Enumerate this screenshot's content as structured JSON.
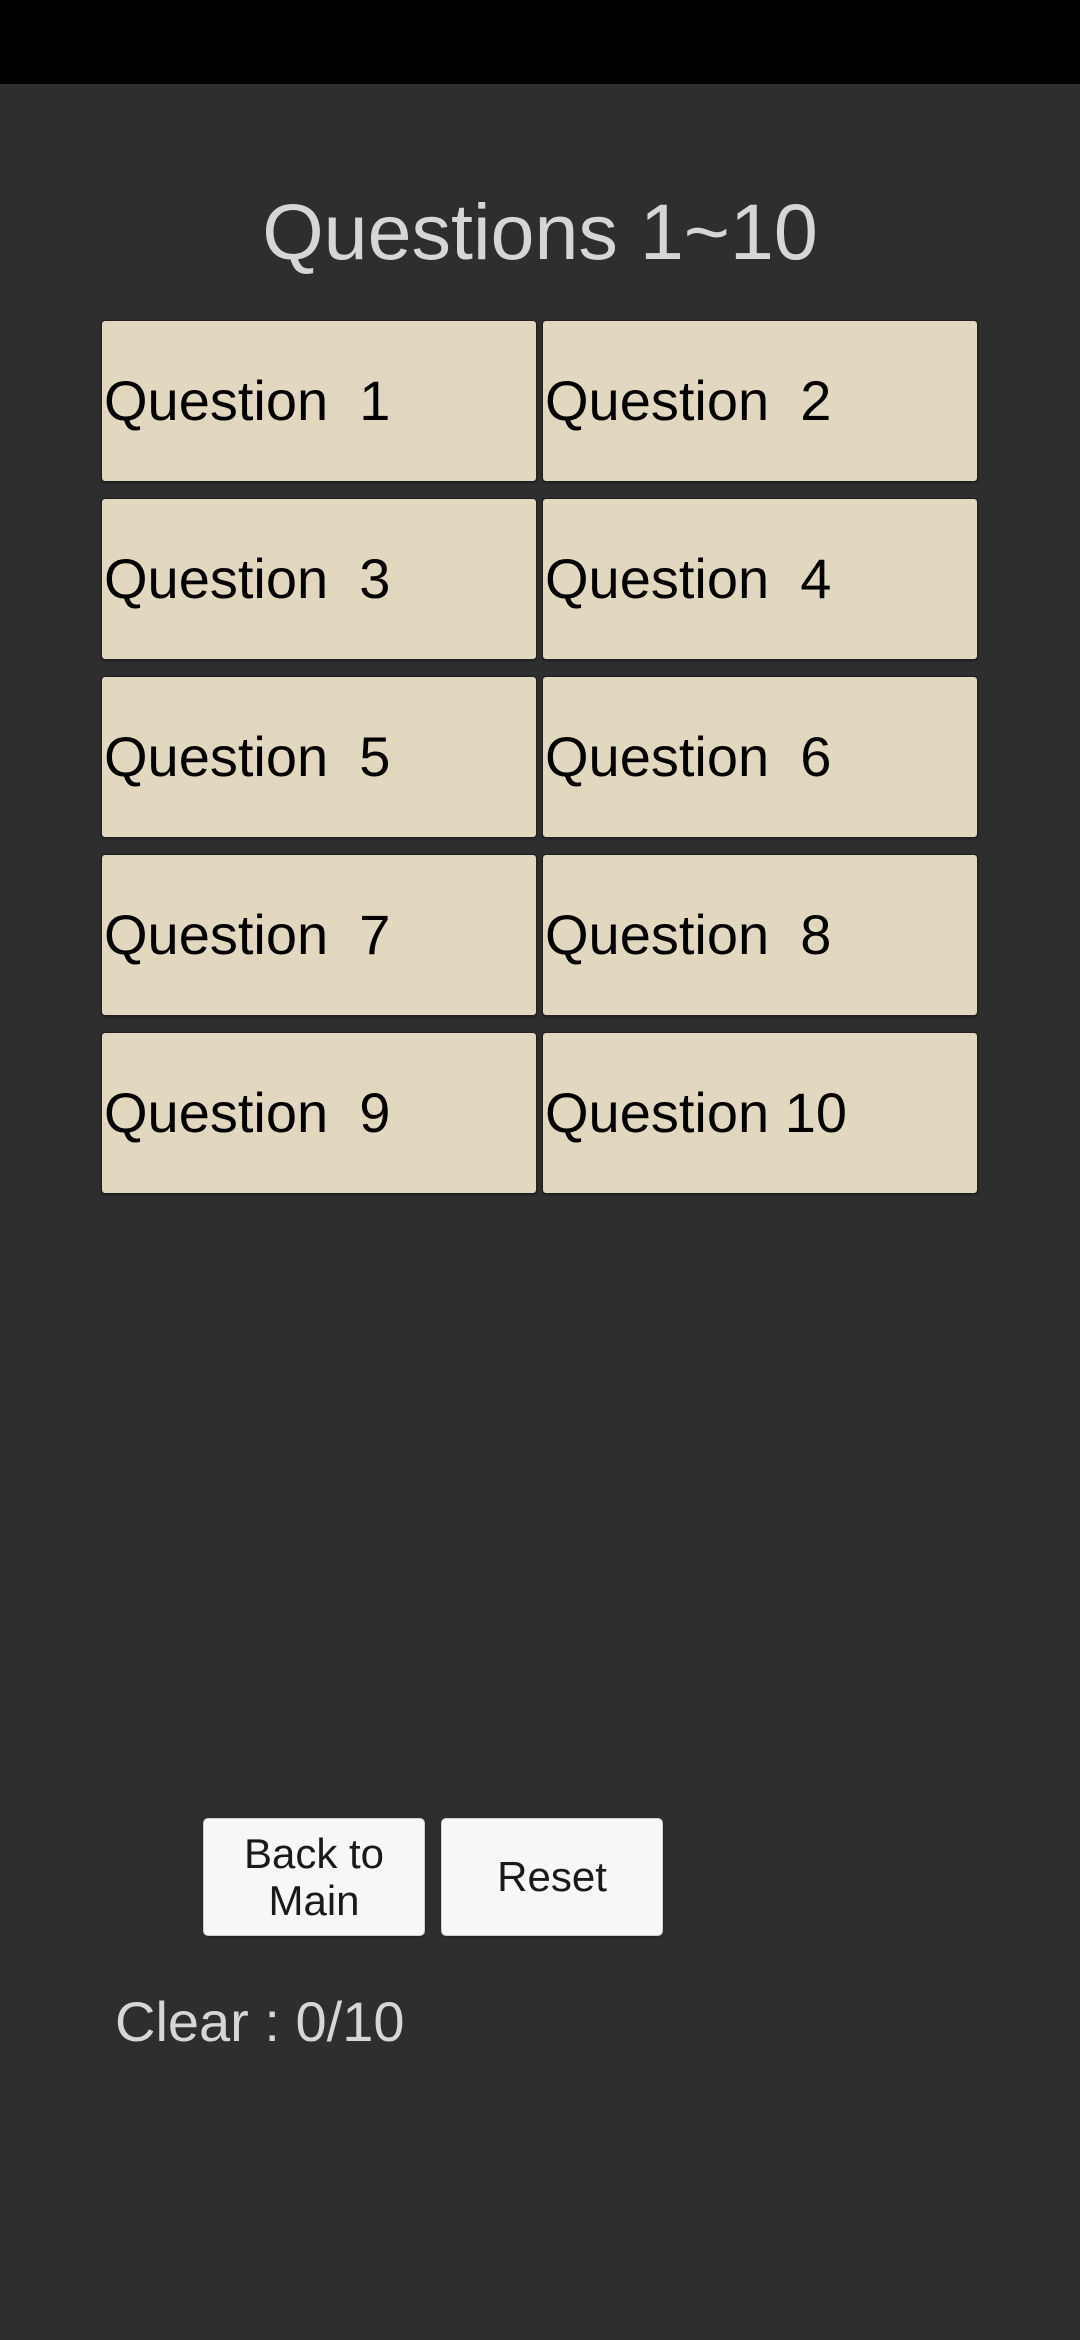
{
  "screen": {
    "background_color": "#2e2e2e",
    "status_bar_color": "#000000"
  },
  "header": {
    "title": "Questions 1~10"
  },
  "colors": {
    "question_button_bg": "#e2d8bf",
    "question_button_border": "#20201e",
    "action_button_bg": "#f7f7f7",
    "text_light": "#d6d6d6",
    "text_dark": "#000000"
  },
  "question_grid": {
    "columns": 2,
    "rows": 5,
    "buttons": [
      {
        "label": "Question  1",
        "number": 1
      },
      {
        "label": "Question  2",
        "number": 2
      },
      {
        "label": "Question  3",
        "number": 3
      },
      {
        "label": "Question  4",
        "number": 4
      },
      {
        "label": "Question  5",
        "number": 5
      },
      {
        "label": "Question  6",
        "number": 6
      },
      {
        "label": "Question  7",
        "number": 7
      },
      {
        "label": "Question  8",
        "number": 8
      },
      {
        "label": "Question  9",
        "number": 9
      },
      {
        "label": "Question 10",
        "number": 10
      }
    ]
  },
  "actions": {
    "back_to_main_label": "Back to\nMain",
    "reset_label": "Reset"
  },
  "status": {
    "clear_label": "Clear : 0/10",
    "cleared_count": 0,
    "total_count": 10
  }
}
